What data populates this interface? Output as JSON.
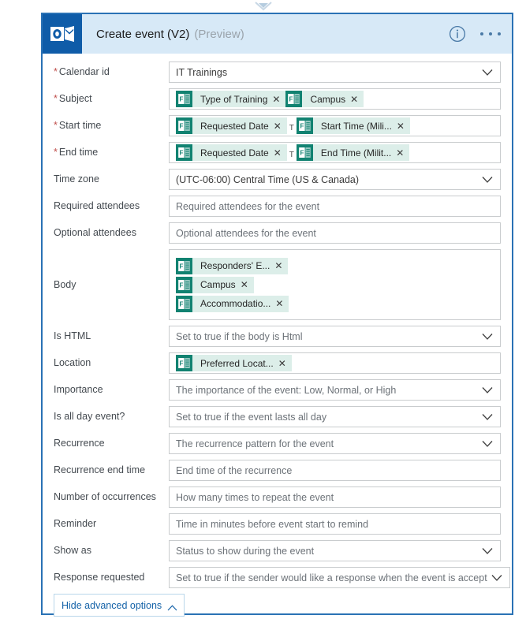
{
  "window": {
    "top_chevron_icon": "chevron-down-icon"
  },
  "card": {
    "header": {
      "brand_icon": "outlook-icon",
      "title": "Create event (V2)",
      "subtitle": "(Preview)",
      "info_icon": "info-icon",
      "more_icon": "ellipsis-icon"
    },
    "fields": [
      {
        "label": "Calendar id",
        "required": true,
        "type": "dropdown",
        "value": "IT Trainings",
        "is_placeholder": false
      },
      {
        "label": "Subject",
        "required": true,
        "type": "tokens",
        "tokens": [
          {
            "text": "Type of Training",
            "icon": "forms-icon"
          },
          {
            "text": "Campus",
            "icon": "forms-icon"
          }
        ]
      },
      {
        "label": "Start time",
        "required": true,
        "type": "tokens",
        "tokens": [
          {
            "text": "Requested Date",
            "icon": "forms-icon"
          },
          {
            "separator": "T"
          },
          {
            "text": "Start Time (Mili...",
            "icon": "forms-icon"
          }
        ]
      },
      {
        "label": "End time",
        "required": true,
        "type": "tokens",
        "tokens": [
          {
            "text": "Requested Date",
            "icon": "forms-icon"
          },
          {
            "separator": "T"
          },
          {
            "text": "End Time (Milit...",
            "icon": "forms-icon"
          }
        ]
      },
      {
        "label": "Time zone",
        "required": false,
        "type": "dropdown",
        "value": "(UTC-06:00) Central Time (US & Canada)",
        "is_placeholder": false
      },
      {
        "label": "Required attendees",
        "required": false,
        "type": "text",
        "value": "Required attendees for the event",
        "is_placeholder": true
      },
      {
        "label": "Optional attendees",
        "required": false,
        "type": "text",
        "value": "Optional attendees for the event",
        "is_placeholder": true
      },
      {
        "label": "Body",
        "required": false,
        "type": "tokens-stacked",
        "tokens": [
          {
            "text": "Responders' E...",
            "icon": "forms-icon"
          },
          {
            "text": "Campus",
            "icon": "forms-icon"
          },
          {
            "text": "Accommodatio...",
            "icon": "forms-icon"
          }
        ]
      },
      {
        "label": "Is HTML",
        "required": false,
        "type": "dropdown",
        "value": "Set to true if the body is Html",
        "is_placeholder": true
      },
      {
        "label": "Location",
        "required": false,
        "type": "tokens",
        "tokens": [
          {
            "text": "Preferred Locat...",
            "icon": "forms-icon"
          }
        ]
      },
      {
        "label": "Importance",
        "required": false,
        "type": "dropdown",
        "value": "The importance of the event: Low, Normal, or High",
        "is_placeholder": true
      },
      {
        "label": "Is all day event?",
        "required": false,
        "type": "dropdown",
        "value": "Set to true if the event lasts all day",
        "is_placeholder": true
      },
      {
        "label": "Recurrence",
        "required": false,
        "type": "dropdown",
        "value": "The recurrence pattern for the event",
        "is_placeholder": true
      },
      {
        "label": "Recurrence end time",
        "required": false,
        "type": "text",
        "value": "End time of the recurrence",
        "is_placeholder": true
      },
      {
        "label": "Number of occurrences",
        "required": false,
        "type": "text",
        "value": "How many times to repeat the event",
        "is_placeholder": true
      },
      {
        "label": "Reminder",
        "required": false,
        "type": "text",
        "value": "Time in minutes before event start to remind",
        "is_placeholder": true
      },
      {
        "label": "Show as",
        "required": false,
        "type": "dropdown",
        "value": "Status to show during the event",
        "is_placeholder": true
      },
      {
        "label": "Response requested",
        "required": false,
        "type": "dropdown",
        "value": "Set to true if the sender would like a response when the event is accept",
        "is_placeholder": true
      }
    ],
    "advanced_toggle": {
      "label": "Hide advanced options",
      "icon": "chevron-up-icon"
    }
  },
  "colors": {
    "card_border": "#2a72b5",
    "header_bg": "#d7e9f7",
    "brand_bg": "#0f5ca8",
    "chip_bg": "#dceee9",
    "chip_icon_bg": "#118271",
    "required_star": "#c0504d",
    "link_blue": "#1462a8"
  }
}
